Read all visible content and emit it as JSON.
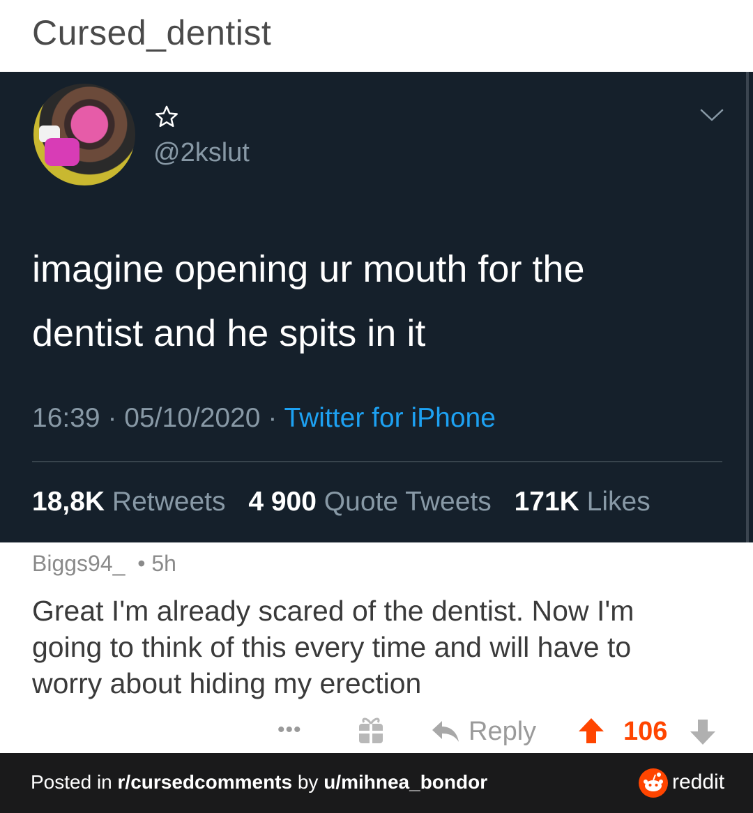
{
  "header": {
    "subreddit_title": "Cursed_dentist"
  },
  "tweet": {
    "handle": "@2kslut",
    "text_lines": [
      "imagine opening ur mouth for the",
      "dentist and he spits in it"
    ],
    "time": "16:39",
    "date": "05/10/2020",
    "source": "Twitter for iPhone",
    "separator": " · ",
    "stats": {
      "retweets_count": "18,8K",
      "retweets_label": "Retweets",
      "quotes_count": "4 900",
      "quotes_label": "Quote Tweets",
      "likes_count": "171K",
      "likes_label": "Likes"
    },
    "colors": {
      "background": "#15202b",
      "link": "#1da1f2",
      "muted": "#8899a6"
    },
    "icons": [
      "star-icon",
      "chevron-down-icon"
    ]
  },
  "comment": {
    "author": "Biggs94_",
    "age": "5h",
    "dot": "•",
    "body_lines": [
      "Great I'm already scared of the dentist. Now I'm",
      "going to think of this every time and will have to",
      "worry about hiding my erection"
    ],
    "actions": {
      "more": "•••",
      "reply_label": "Reply",
      "score": "106"
    },
    "icons": [
      "more-icon",
      "gift-icon",
      "reply-icon",
      "upvote-icon",
      "downvote-icon"
    ],
    "colors": {
      "upvoted": "#ff4500"
    }
  },
  "footer": {
    "posted_in_prefix": "Posted in ",
    "subreddit": "r/cursedcomments",
    "by": " by ",
    "user": "u/mihnea_bondor",
    "brand": "reddit",
    "colors": {
      "background": "#1a1a1b",
      "brand": "#ff4500"
    }
  }
}
